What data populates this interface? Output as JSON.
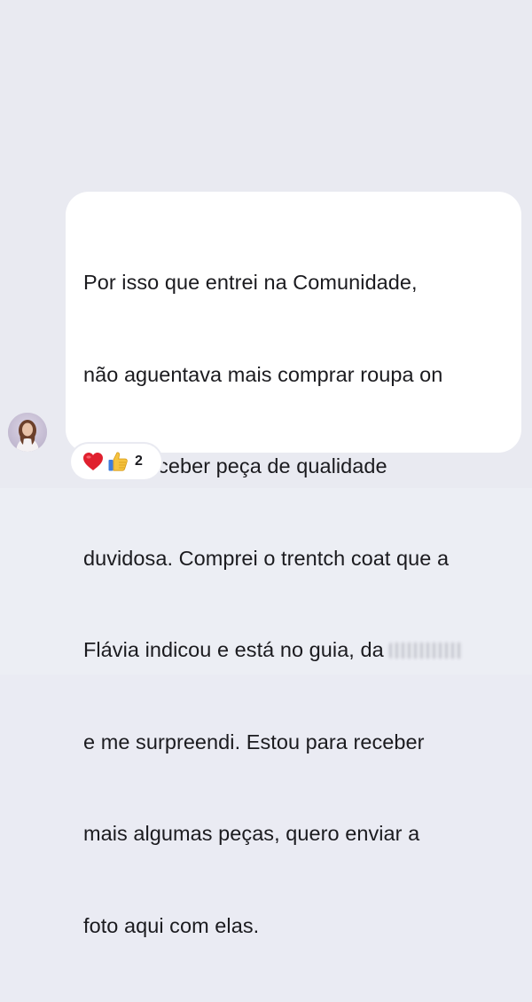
{
  "message": {
    "lines": [
      "Por isso que entrei na Comunidade,",
      "não aguentava mais comprar roupa on",
      "line e receber peça de qualidade",
      "duvidosa. Comprei o trentch coat que a",
      "Flávia indicou e está no guia, da",
      "e me surpreendi. Estou para receber",
      "mais algumas peças,  quero enviar a",
      "foto aqui com elas."
    ]
  },
  "reactions": {
    "icons": [
      "red-heart-icon",
      "thumbs-up-icon"
    ],
    "count": "2"
  },
  "colors": {
    "background": "#e9eaf1",
    "bubble": "#ffffff",
    "text": "#1b1b1f",
    "heart": "#e0202e",
    "thumb": "#f6c33f"
  }
}
